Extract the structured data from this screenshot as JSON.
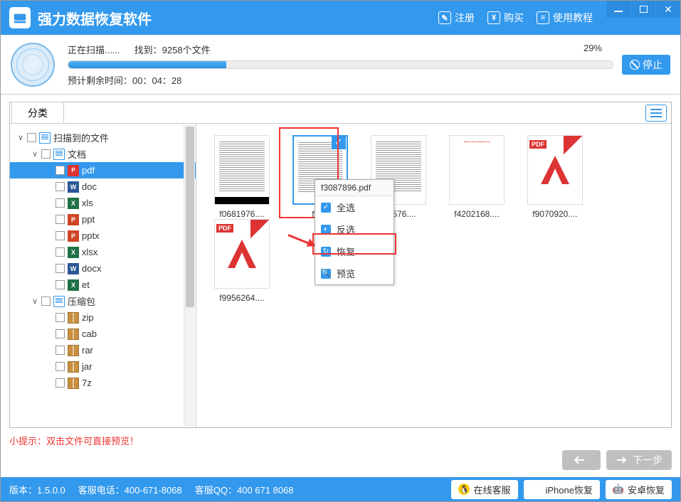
{
  "titlebar": {
    "app_title": "强力数据恢复软件",
    "register": "注册",
    "buy": "购买",
    "tutorial": "使用教程"
  },
  "scan": {
    "scanning": "正在扫描......",
    "found_label": "找到：9258个文件",
    "percent": "29%",
    "percent_value": 29,
    "eta": "预计剩余时间：00：04：28",
    "stop": "停止"
  },
  "tabs": {
    "category": "分类"
  },
  "tree": [
    {
      "indent": 0,
      "expander": "∨",
      "icon": "doc",
      "label": "扫描到的文件"
    },
    {
      "indent": 1,
      "expander": "∨",
      "icon": "doc",
      "label": "文档"
    },
    {
      "indent": 2,
      "expander": "",
      "icon": "pdf",
      "label": "pdf",
      "selected": true
    },
    {
      "indent": 2,
      "expander": "",
      "icon": "word",
      "label": "doc"
    },
    {
      "indent": 2,
      "expander": "",
      "icon": "xls",
      "label": "xls"
    },
    {
      "indent": 2,
      "expander": "",
      "icon": "ppt",
      "label": "ppt"
    },
    {
      "indent": 2,
      "expander": "",
      "icon": "ppt",
      "label": "pptx"
    },
    {
      "indent": 2,
      "expander": "",
      "icon": "xls",
      "label": "xlsx"
    },
    {
      "indent": 2,
      "expander": "",
      "icon": "word",
      "label": "docx"
    },
    {
      "indent": 2,
      "expander": "",
      "icon": "xls",
      "label": "et"
    },
    {
      "indent": 1,
      "expander": "∨",
      "icon": "doc",
      "label": "压缩包"
    },
    {
      "indent": 2,
      "expander": "",
      "icon": "zip",
      "label": "zip"
    },
    {
      "indent": 2,
      "expander": "",
      "icon": "zip",
      "label": "cab"
    },
    {
      "indent": 2,
      "expander": "",
      "icon": "zip",
      "label": "rar"
    },
    {
      "indent": 2,
      "expander": "",
      "icon": "zip",
      "label": "jar"
    },
    {
      "indent": 2,
      "expander": "",
      "icon": "zip",
      "label": "7z"
    }
  ],
  "files": [
    {
      "name": "f0681976....",
      "kind": "text-blackbar"
    },
    {
      "name": "f308",
      "kind": "text",
      "selected": true,
      "full_name": "f3087896.pdf"
    },
    {
      "name": "i31576....",
      "kind": "text"
    },
    {
      "name": "f4202168....",
      "kind": "sparse"
    },
    {
      "name": "f9070920....",
      "kind": "pdf"
    },
    {
      "name": "f9956264....",
      "kind": "pdf"
    }
  ],
  "context_menu": {
    "title": "f3087896.pdf",
    "select_all": "全选",
    "invert": "反选",
    "recover": "恢复",
    "preview": "预览"
  },
  "hint": "小提示：双击文件可直接预览！",
  "actions": {
    "next": "下一步"
  },
  "footer": {
    "version_label": "版本：",
    "version": "1.5.0.0",
    "phone_label": "客服电话：",
    "phone": "400-671-8068",
    "qq_label": "客服QQ：",
    "qq": "400 671 8068",
    "online": "在线客服",
    "iphone": "iPhone恢复",
    "android": "安卓恢复"
  }
}
